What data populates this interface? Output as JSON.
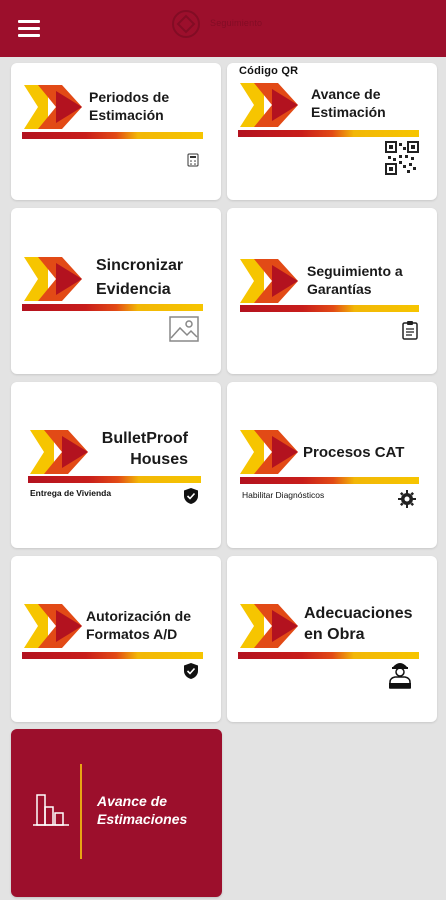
{
  "colors": {
    "brand": "#9c0f2c",
    "accent_red": "#c81d1b",
    "accent_yellow": "#f6c500",
    "accent_orange": "#e24a16",
    "line_gold": "#e7a514"
  },
  "appbar": {
    "menu_icon": "hamburger-menu-icon",
    "logo_text": "Seguimiento"
  },
  "cards": [
    {
      "title_lines": [
        "Periodos de",
        "Estimación"
      ],
      "icon": "calculator-icon"
    },
    {
      "header": "Código QR",
      "title_lines": [
        "Avance de",
        "Estimación"
      ],
      "icon": "qr-code-icon"
    },
    {
      "title_lines": [
        "Sincronizar",
        "Evidencia"
      ],
      "icon": "image-icon"
    },
    {
      "title_lines": [
        "Seguimiento a",
        "Garantías"
      ],
      "icon": "clipboard-icon"
    },
    {
      "title_lines": [
        "BulletProof",
        "Houses"
      ],
      "subtitle": "Entrega de Vivienda",
      "icon": "shield-check-icon"
    },
    {
      "title_lines": [
        "Procesos CAT"
      ],
      "subtitle": "Habilitar Diagnósticos",
      "icon": "gear-icon"
    },
    {
      "title_lines": [
        "Autorización de",
        "Formatos A/D"
      ],
      "icon": "shield-check-icon"
    },
    {
      "title_lines": [
        "Adecuaciones",
        "en Obra"
      ],
      "icon": "worker-icon"
    }
  ],
  "big_card": {
    "title_lines": [
      "Avance de",
      "Estimaciones"
    ],
    "icon": "bar-chart-icon"
  }
}
